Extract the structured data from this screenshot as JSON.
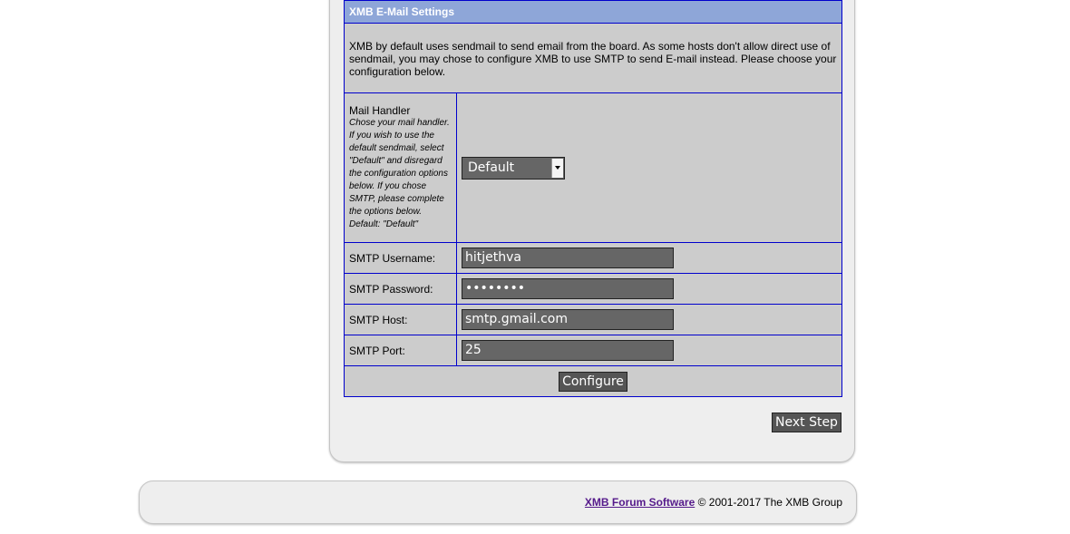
{
  "settings": {
    "title": "XMB E-Mail Settings",
    "description": "XMB by default uses sendmail to send email from the board. As some hosts don't allow direct use of sendmail, you may chose to configure XMB to use SMTP to send E-mail instead. Please choose your configuration below.",
    "mail_handler": {
      "label": "Mail Handler",
      "help": "Chose your mail handler. If you wish to use the default sendmail, select \"Default\" and disregard the configuration options below. If you chose SMTP, please complete the options below. Default: \"Default\"",
      "selected": "Default"
    },
    "smtp_username": {
      "label": "SMTP Username:",
      "value": "hitjethva"
    },
    "smtp_password": {
      "label": "SMTP Password:",
      "value": "••••••••"
    },
    "smtp_host": {
      "label": "SMTP Host:",
      "value": "smtp.gmail.com"
    },
    "smtp_port": {
      "label": "SMTP Port:",
      "value": "25"
    },
    "configure_label": "Configure"
  },
  "next_step_label": "Next Step",
  "footer": {
    "link_text": "XMB Forum Software",
    "copyright": "© 2001-2017 The XMB Group"
  }
}
